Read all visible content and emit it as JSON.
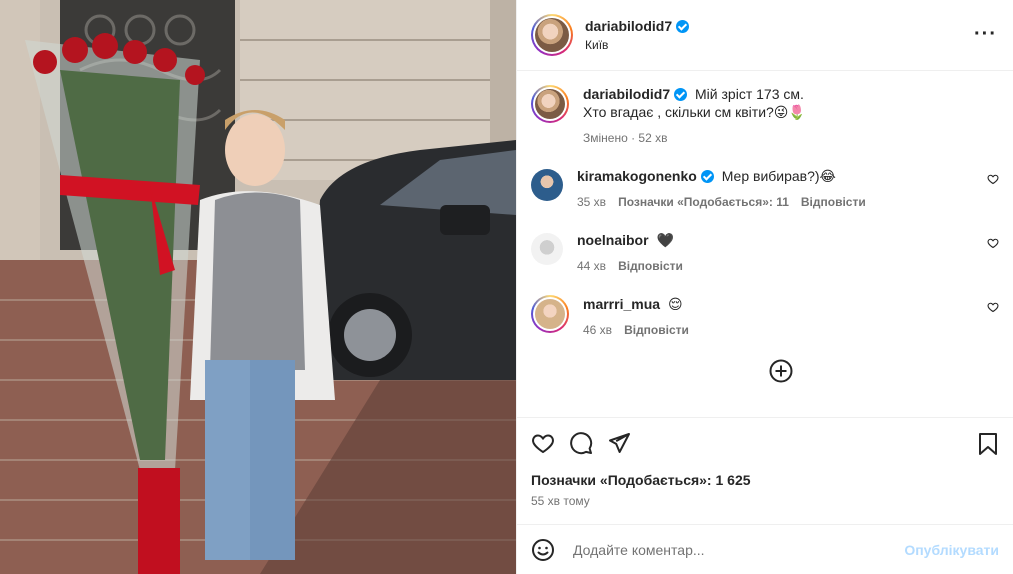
{
  "post": {
    "author": "dariabilodid7",
    "location": "Київ",
    "more_icon": "more-horizontal-icon",
    "image": {
      "description_icon": "photo"
    }
  },
  "caption": {
    "username": "dariabilodid7",
    "text_line1": "Мій зріст 173 см.",
    "text_line2": "Хто вгадає , скільки см квіти?😜🌷",
    "meta": "Змінено · 52 хв"
  },
  "comments": [
    {
      "username": "kiramakogonenko",
      "verified": true,
      "text": "Мер вибирав?)😂",
      "time": "35 хв",
      "likes": "Позначки «Подобається»: 11",
      "reply": "Відповісти"
    },
    {
      "username": "noelnaibor",
      "verified": false,
      "text": "🖤",
      "time": "44 хв",
      "likes": "",
      "reply": "Відповісти"
    },
    {
      "username": "marrri_mua",
      "verified": false,
      "text": "😌",
      "time": "46 хв",
      "likes": "",
      "reply": "Відповісти"
    }
  ],
  "actions": {
    "likes_total": "Позначки «Подобається»: 1 625",
    "time_ago": "55 хв тому"
  },
  "add_comment": {
    "placeholder": "Додайте коментар...",
    "publish": "Опублікувати"
  },
  "colors": {
    "link_blue": "#0095f6",
    "publish_disabled": "#b3dbff",
    "muted": "#737373"
  }
}
